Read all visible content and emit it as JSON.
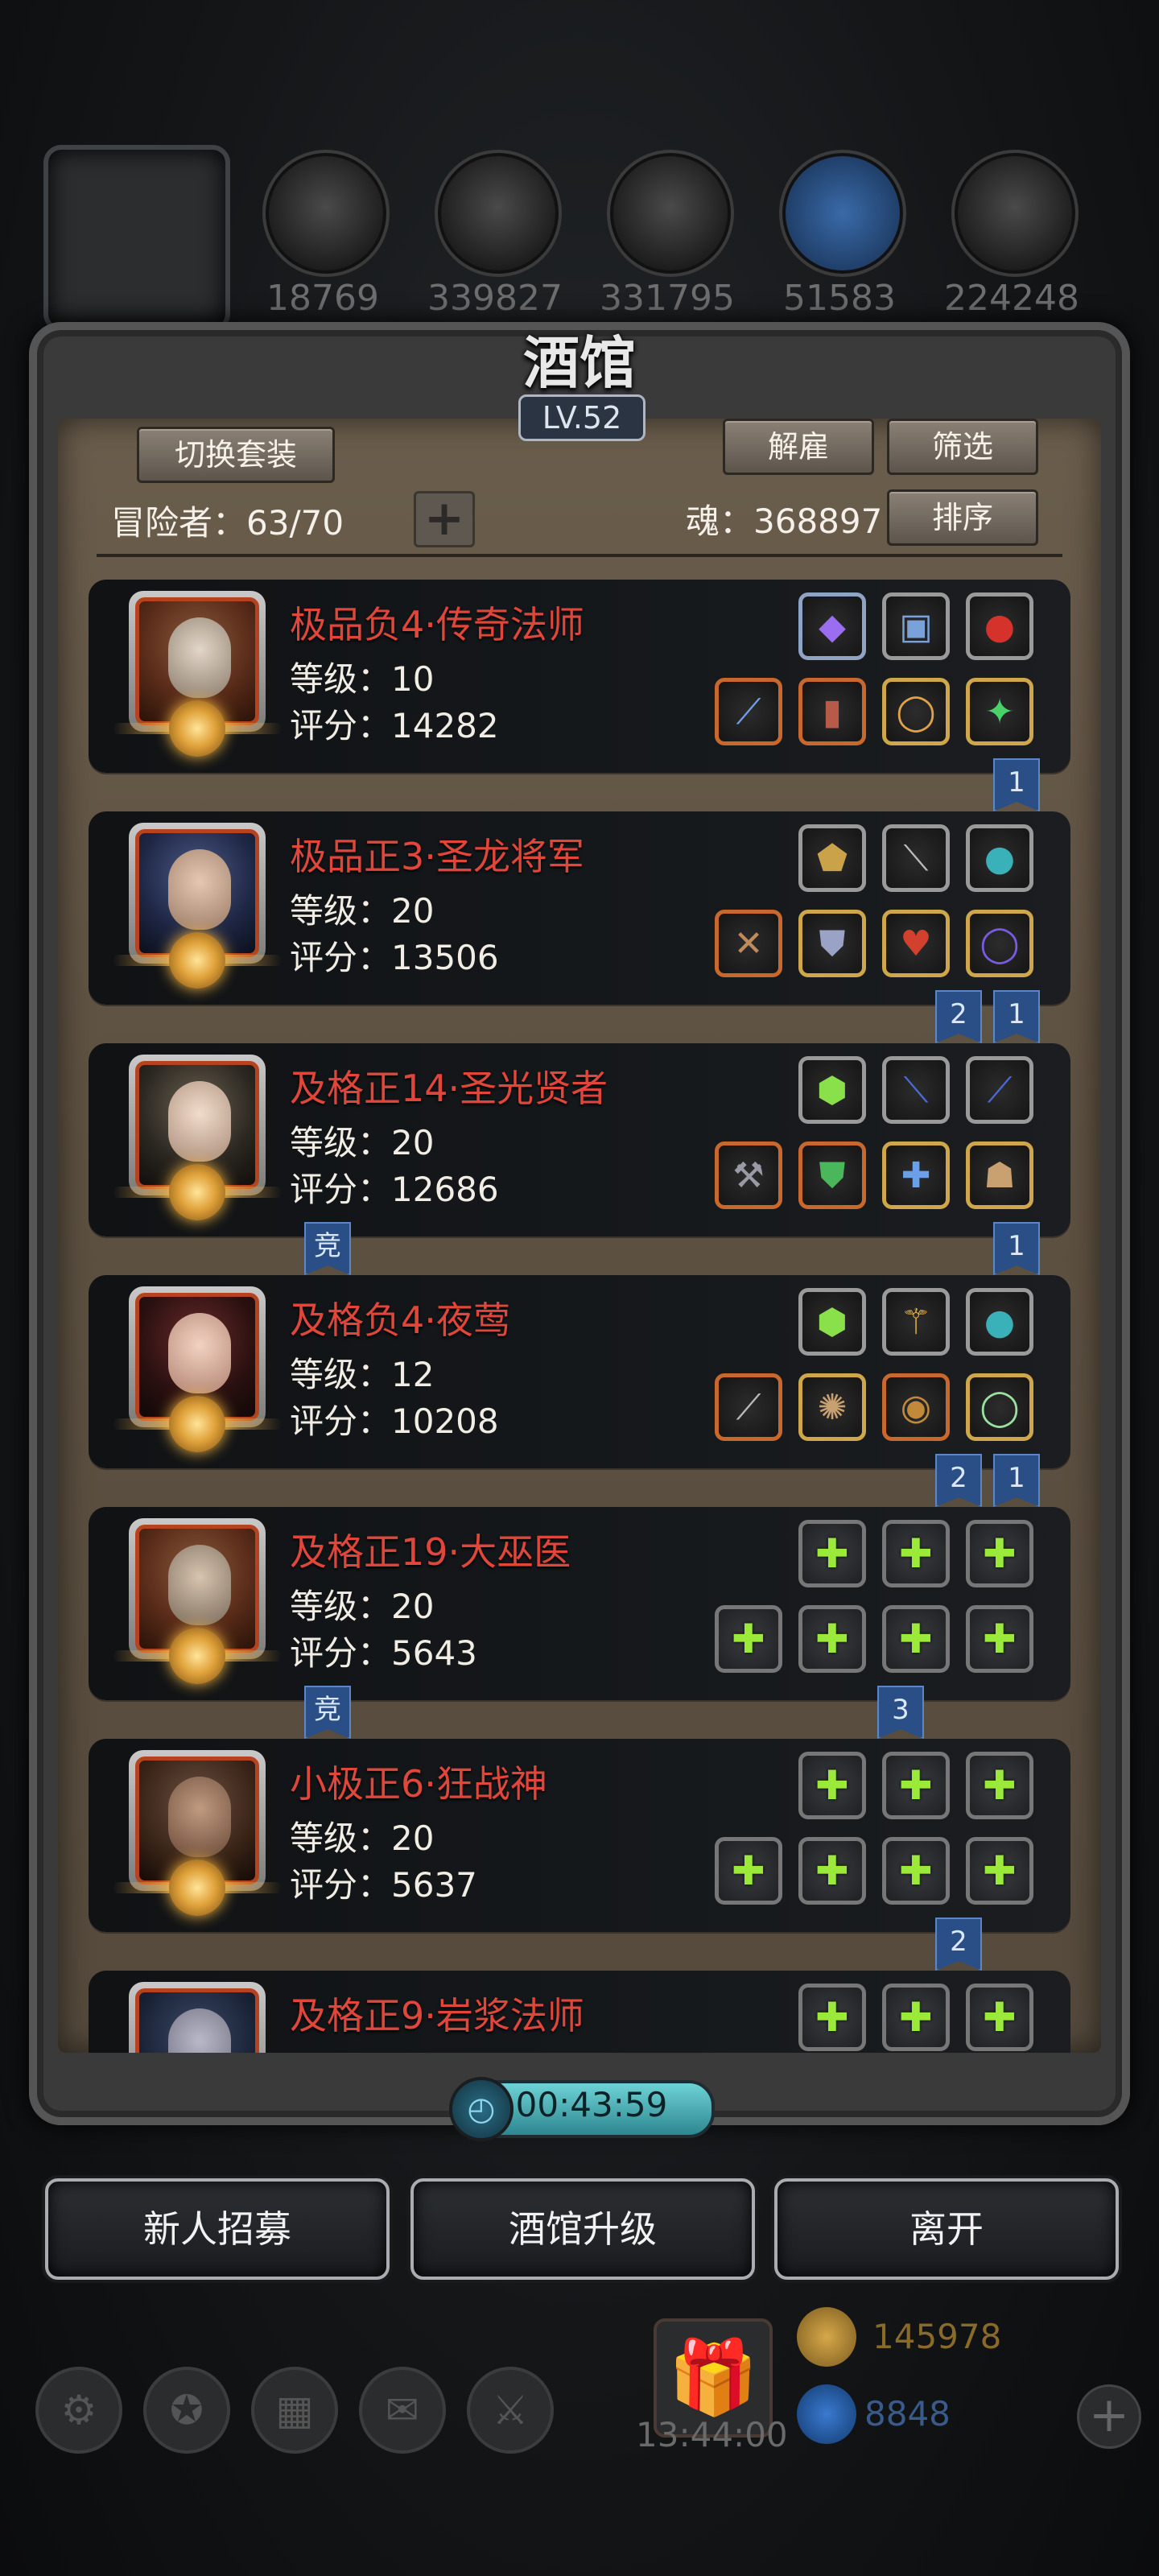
{
  "resources": [
    {
      "icon": "meat-icon",
      "value": "18769"
    },
    {
      "icon": "wood-icon",
      "value": "339827"
    },
    {
      "icon": "stone-icon",
      "value": "331795"
    },
    {
      "icon": "crystal-icon",
      "value": "51583"
    },
    {
      "icon": "iron-icon",
      "value": "224248"
    }
  ],
  "tavern": {
    "title": "酒馆",
    "level": "LV.52",
    "switch_set_label": "切换套装",
    "dismiss_label": "解雇",
    "filter_label": "筛选",
    "sort_label": "排序",
    "adventurers_label": "冒险者：63/70",
    "add_symbol": "+",
    "soul_label": "魂：368897"
  },
  "heroes": [
    {
      "name": "极品负4·传奇法师",
      "level": "等级：10",
      "score": "评分：14282",
      "tags_left": [],
      "tags_right": [
        "1"
      ]
    },
    {
      "name": "极品正3·圣龙将军",
      "level": "等级：20",
      "score": "评分：13506",
      "tags_left": [],
      "tags_right": [
        "2",
        "1"
      ]
    },
    {
      "name": "及格正14·圣光贤者",
      "level": "等级：20",
      "score": "评分：12686",
      "tags_left": [
        "竞"
      ],
      "tags_right": [
        "1"
      ]
    },
    {
      "name": "及格负4·夜莺",
      "level": "等级：12",
      "score": "评分：10208",
      "tags_left": [],
      "tags_right": [
        "2",
        "1"
      ]
    },
    {
      "name": "及格正19·大巫医",
      "level": "等级：20",
      "score": "评分：5643",
      "tags_left": [
        "竞"
      ],
      "tags_right": [
        "3"
      ]
    },
    {
      "name": "小极正6·狂战神",
      "level": "等级：20",
      "score": "评分：5637",
      "tags_left": [],
      "tags_right": [
        "2"
      ]
    },
    {
      "name": "及格正9·岩浆法师",
      "level": "",
      "score": "",
      "tags_left": [],
      "tags_right": []
    }
  ],
  "timer": "00:43:59",
  "buttons": {
    "recruit": "新人招募",
    "upgrade": "酒馆升级",
    "leave": "离开"
  },
  "footer": {
    "gift_timer": "13:44:00",
    "gold": "145978",
    "gems": "8848"
  }
}
